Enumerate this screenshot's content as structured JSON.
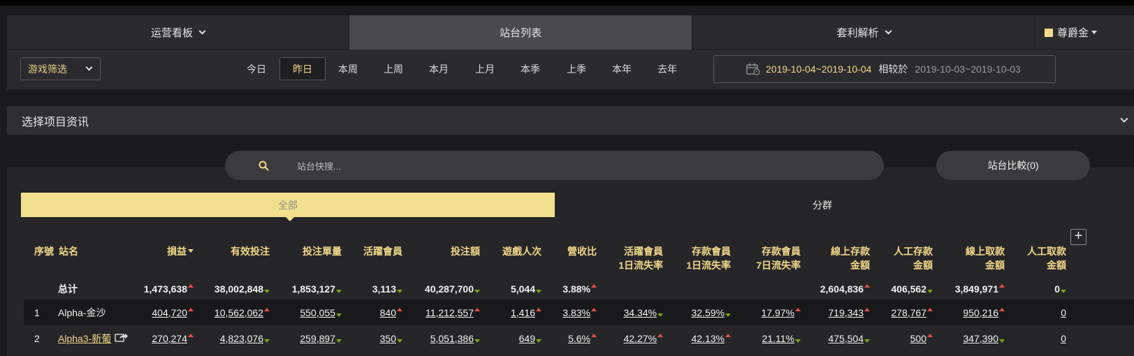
{
  "nav": {
    "tabs": [
      {
        "label": "运营看板"
      },
      {
        "label": "站台列表"
      },
      {
        "label": "套利解析"
      }
    ],
    "vip_label": "尊爵金"
  },
  "filter": {
    "game_select": "游戏筛选",
    "date_buttons": [
      "今日",
      "昨日",
      "本周",
      "上周",
      "本月",
      "上月",
      "本季",
      "上季",
      "本年",
      "去年"
    ],
    "selected_date": "昨日",
    "range": "2019-10-04~2019-10-04",
    "compare_label": "相较於",
    "compare_range": "2019-10-03~2019-10-03"
  },
  "project": {
    "title": "选择项目资讯"
  },
  "search": {
    "placeholder": "站台快搜..."
  },
  "compare_button": "站台比較(0)",
  "segments": {
    "all": "全部",
    "group": "分群"
  },
  "plus": "+",
  "table": {
    "headers": [
      {
        "l1": "序號",
        "l2": ""
      },
      {
        "l1": "站名",
        "l2": ""
      },
      {
        "l1": "損益",
        "l2": ""
      },
      {
        "l1": "有效投注",
        "l2": ""
      },
      {
        "l1": "投注單量",
        "l2": ""
      },
      {
        "l1": "活躍會員",
        "l2": ""
      },
      {
        "l1": "投注額",
        "l2": ""
      },
      {
        "l1": "遊戲人次",
        "l2": ""
      },
      {
        "l1": "營收比",
        "l2": ""
      },
      {
        "l1": "活躍會員",
        "l2": "1日流失率"
      },
      {
        "l1": "存款會員",
        "l2": "1日流失率"
      },
      {
        "l1": "存款會員",
        "l2": "7日流失率"
      },
      {
        "l1": "線上存款",
        "l2": "金額"
      },
      {
        "l1": "人工存款",
        "l2": "金額"
      },
      {
        "l1": "線上取款",
        "l2": "金額"
      },
      {
        "l1": "人工取款",
        "l2": "金額"
      }
    ],
    "rows": [
      {
        "idx": "",
        "name": "总计",
        "cells": [
          {
            "v": "1,473,638",
            "t": "up"
          },
          {
            "v": "38,002,848",
            "t": "down"
          },
          {
            "v": "1,853,127",
            "t": "down"
          },
          {
            "v": "3,113",
            "t": "down"
          },
          {
            "v": "40,287,700",
            "t": "down"
          },
          {
            "v": "5,044",
            "t": "down"
          },
          {
            "v": "3.88%",
            "t": "up"
          },
          {
            "v": "",
            "t": ""
          },
          {
            "v": "",
            "t": ""
          },
          {
            "v": "",
            "t": ""
          },
          {
            "v": "2,604,836",
            "t": "up"
          },
          {
            "v": "406,562",
            "t": "down"
          },
          {
            "v": "3,849,971",
            "t": "up"
          },
          {
            "v": "0",
            "t": "down"
          }
        ]
      },
      {
        "idx": "1",
        "name_a": "Alpha",
        "name_b": "-金沙",
        "cells": [
          {
            "v": "404,720",
            "t": "up"
          },
          {
            "v": "10,562,062",
            "t": "up"
          },
          {
            "v": "550,055",
            "t": "down"
          },
          {
            "v": "840",
            "t": "up"
          },
          {
            "v": "11,212,557",
            "t": "up"
          },
          {
            "v": "1,416",
            "t": "up"
          },
          {
            "v": "3.83%",
            "t": "up"
          },
          {
            "v": "34.34%",
            "t": "down"
          },
          {
            "v": "32.59%",
            "t": "down"
          },
          {
            "v": "17.97%",
            "t": "up"
          },
          {
            "v": "719,343",
            "t": "up"
          },
          {
            "v": "278,767",
            "t": "up"
          },
          {
            "v": "950,216",
            "t": "up"
          },
          {
            "v": "0",
            "t": ""
          }
        ]
      },
      {
        "idx": "2",
        "name_a": "Alpha3",
        "name_b": "-新葡",
        "cells": [
          {
            "v": "270,274",
            "t": "up"
          },
          {
            "v": "4,823,076",
            "t": "down"
          },
          {
            "v": "259,897",
            "t": "down"
          },
          {
            "v": "350",
            "t": "down"
          },
          {
            "v": "5,051,386",
            "t": "down"
          },
          {
            "v": "649",
            "t": "down"
          },
          {
            "v": "5.6%",
            "t": "up"
          },
          {
            "v": "42.27%",
            "t": "up"
          },
          {
            "v": "42.13%",
            "t": "up"
          },
          {
            "v": "21.11%",
            "t": "down"
          },
          {
            "v": "475,504",
            "t": "down"
          },
          {
            "v": "500",
            "t": "up"
          },
          {
            "v": "347,390",
            "t": "down"
          },
          {
            "v": "0",
            "t": ""
          }
        ]
      }
    ]
  },
  "colors": {
    "accent": "#f3e08f",
    "gold_text": "#f0d78a",
    "up": "#e04f4f",
    "down": "#7aa21a",
    "bg": "#1b1b1e"
  }
}
